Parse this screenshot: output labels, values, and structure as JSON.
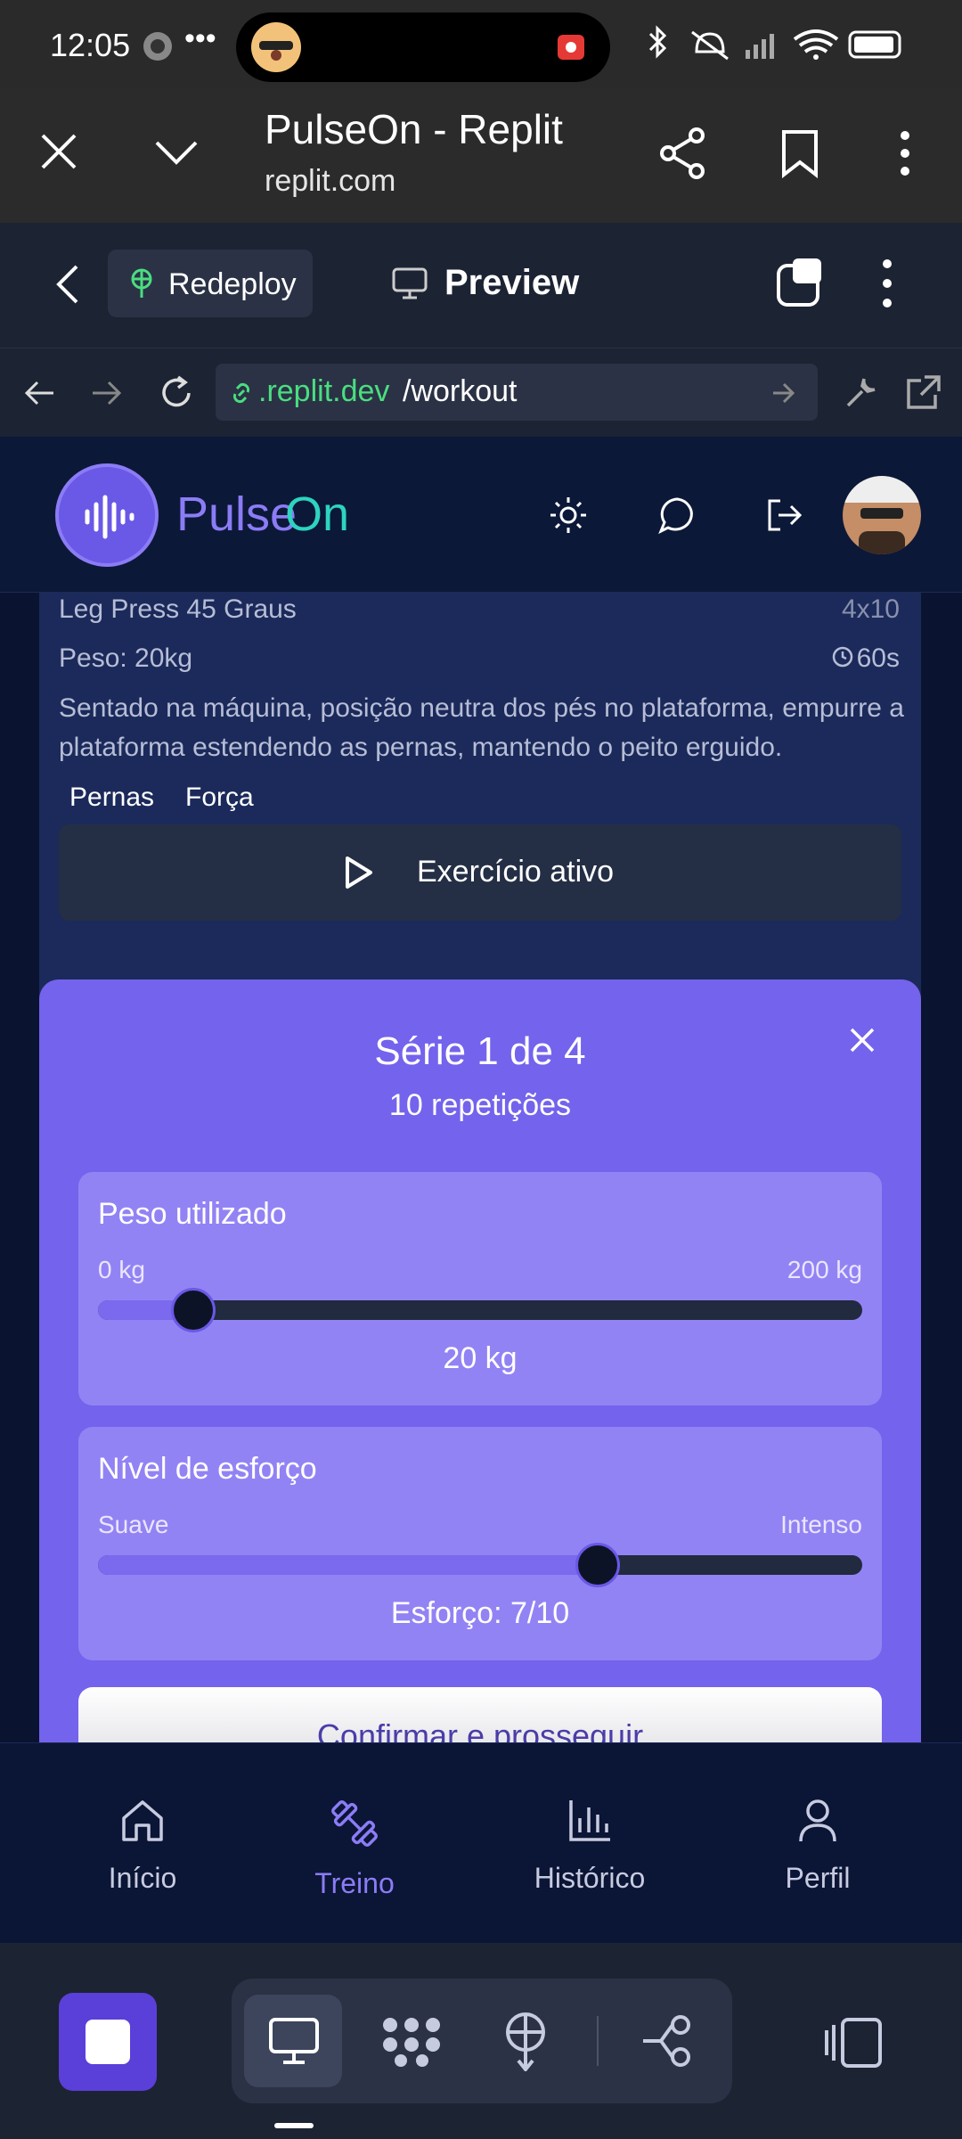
{
  "status_bar": {
    "time": "12:05",
    "dots": "•••"
  },
  "browser": {
    "title": "PulseOn - Replit",
    "domain": "replit.com"
  },
  "replit_toolbar": {
    "redeploy_label": "Redeploy",
    "preview_label": "Preview"
  },
  "address_bar": {
    "host": ".replit.dev",
    "path": "/workout"
  },
  "app_header": {
    "brand_part1": "Pulse",
    "brand_part2": "On"
  },
  "exercise": {
    "name": "Leg Press 45 Graus",
    "sets_reps": "4x10",
    "weight": "Peso: 20kg",
    "rest": "60s",
    "description": "Sentado na máquina, posição neutra dos pés no plataforma, empurre a plataforma estendendo as pernas, mantendo o peito erguido.",
    "tags": [
      "Pernas",
      "Força"
    ],
    "active_button": "Exercício ativo"
  },
  "serie_card": {
    "title": "Série 1 de 4",
    "subtitle": "10 repetições",
    "weight_panel": {
      "label": "Peso utilizado",
      "min": "0 kg",
      "max": "200 kg",
      "value_text": "20 kg",
      "value_kg": 20,
      "max_kg": 200
    },
    "effort_panel": {
      "label": "Nível de esforço",
      "min": "Suave",
      "max": "Intenso",
      "value_text": "Esforço: 7/10",
      "value": 7,
      "max_value": 10
    },
    "confirm_button": "Confirmar e prosseguir"
  },
  "bottom_nav": [
    {
      "label": "Início",
      "icon": "home-icon",
      "active": false
    },
    {
      "label": "Treino",
      "icon": "dumbbell-icon",
      "active": true
    },
    {
      "label": "Histórico",
      "icon": "chart-icon",
      "active": false
    },
    {
      "label": "Perfil",
      "icon": "user-icon",
      "active": false
    }
  ],
  "colors": {
    "accent": "#7463ec",
    "brand_pulse": "#8b7cf6",
    "brand_on": "#2dd4bf",
    "url_green": "#4ade80",
    "nav_active": "#8b7cf6"
  }
}
